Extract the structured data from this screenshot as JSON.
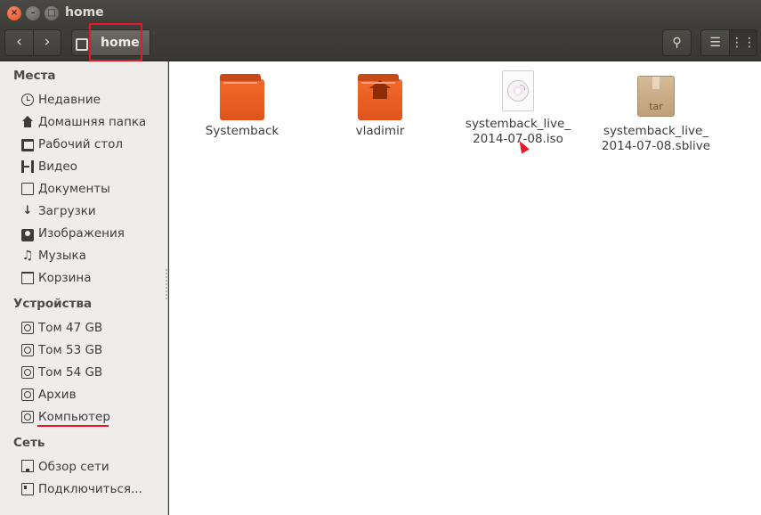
{
  "window": {
    "title": "home",
    "close_glyph": "×",
    "minimize_glyph": "–",
    "maximize_glyph": "□"
  },
  "toolbar": {
    "back_icon": "‹",
    "forward_icon": "›",
    "path": [
      "home"
    ],
    "search_icon": "⚲",
    "list_view_icon": "☰",
    "grid_view_icon": "⋮⋮",
    "active_view": "grid"
  },
  "sidebar": {
    "sections": [
      {
        "title": "Места",
        "items": [
          {
            "label": "Недавние",
            "icon": "clock-icon"
          },
          {
            "label": "Домашняя папка",
            "icon": "home-icon"
          },
          {
            "label": "Рабочий стол",
            "icon": "desktop-icon"
          },
          {
            "label": "Видео",
            "icon": "video-icon"
          },
          {
            "label": "Документы",
            "icon": "document-icon"
          },
          {
            "label": "Загрузки",
            "icon": "download-icon"
          },
          {
            "label": "Изображения",
            "icon": "camera-icon"
          },
          {
            "label": "Музыка",
            "icon": "music-icon"
          },
          {
            "label": "Корзина",
            "icon": "trash-icon"
          }
        ]
      },
      {
        "title": "Устройства",
        "items": [
          {
            "label": "Том 47 GB",
            "icon": "drive-icon"
          },
          {
            "label": "Том 53 GB",
            "icon": "drive-icon"
          },
          {
            "label": "Том 54 GB",
            "icon": "drive-icon"
          },
          {
            "label": "Архив",
            "icon": "drive-icon"
          },
          {
            "label": "Компьютер",
            "icon": "drive-icon"
          }
        ]
      },
      {
        "title": "Сеть",
        "items": [
          {
            "label": "Обзор сети",
            "icon": "network-icon"
          },
          {
            "label": "Подключиться...",
            "icon": "connect-icon"
          }
        ]
      }
    ]
  },
  "files": [
    {
      "name_line1": "Systemback",
      "name_line2": "",
      "type": "folder"
    },
    {
      "name_line1": "vladimir",
      "name_line2": "",
      "type": "home-folder"
    },
    {
      "name_line1": "systemback_live_",
      "name_line2": "2014-07-08.iso",
      "type": "iso"
    },
    {
      "name_line1": "systemback_live_",
      "name_line2": "2014-07-08.sblive",
      "type": "tar",
      "badge": "tar"
    }
  ],
  "colors": {
    "accent_folder": "#e0541b",
    "annotation_red": "#e8182a",
    "titlebar": "#3c3b37"
  }
}
